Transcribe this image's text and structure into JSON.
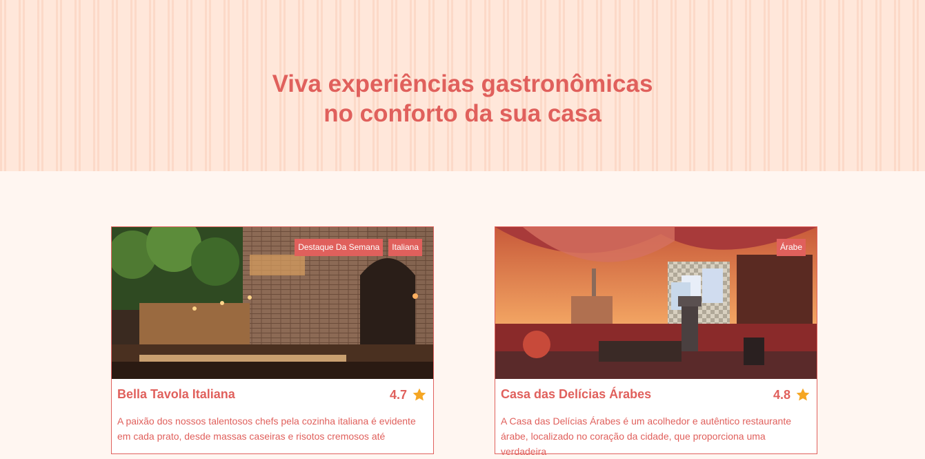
{
  "hero": {
    "title": "Viva experiências gastronômicas\nno conforto da sua casa"
  },
  "restaurants": [
    {
      "name": "Bella Tavola Italiana",
      "rating": "4.7",
      "badges": [
        "Destaque Da Semana",
        "Italiana"
      ],
      "description": "A paixão dos nossos talentosos chefs pela cozinha italiana é evidente em cada prato, desde massas caseiras e risotos cremosos até"
    },
    {
      "name": "Casa das Delícias Árabes",
      "rating": "4.8",
      "badges": [
        "Árabe"
      ],
      "description": "A Casa das Delícias Árabes é um acolhedor e autêntico restaurante árabe, localizado no coração da cidade, que proporciona uma verdadeira"
    }
  ],
  "icons": {
    "rating": "star-icon"
  },
  "colors": {
    "accent": "#e0605c",
    "star": "#f5a623",
    "hero_bg": "#ffe7da",
    "page_bg": "#fff6f1"
  }
}
